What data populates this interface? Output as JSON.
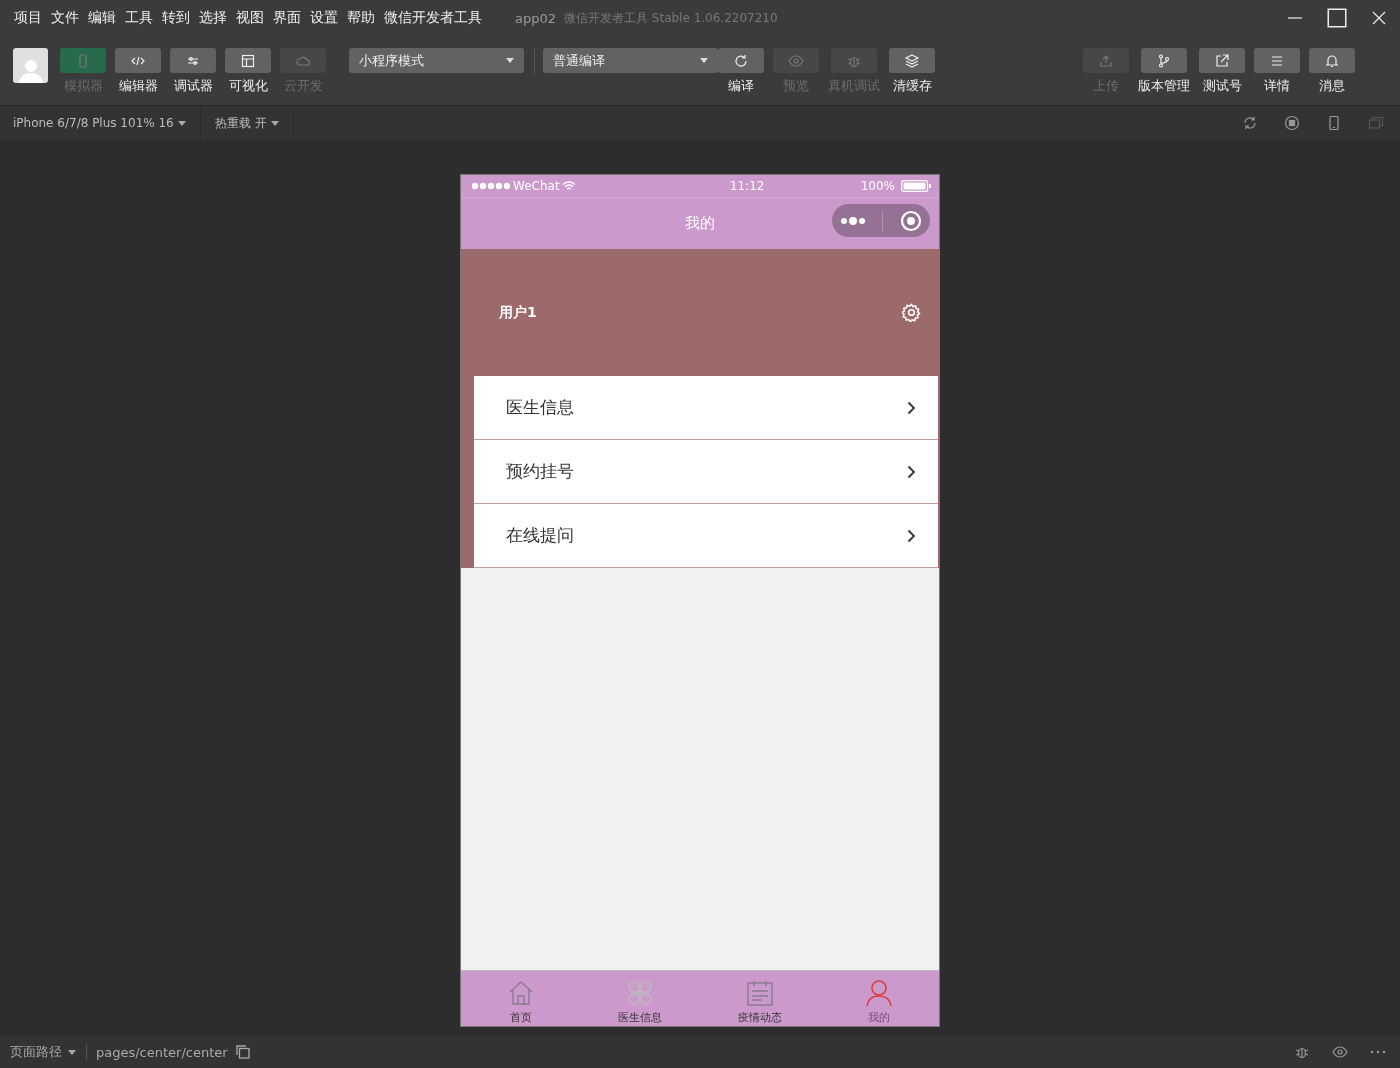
{
  "menu": [
    "项目",
    "文件",
    "编辑",
    "工具",
    "转到",
    "选择",
    "视图",
    "界面",
    "设置",
    "帮助",
    "微信开发者工具"
  ],
  "window": {
    "title": "app02",
    "subtitle": "微信开发者工具 Stable 1.06.2207210"
  },
  "left_tools": [
    {
      "label": "模拟器",
      "selected": true,
      "disabled": true
    },
    {
      "label": "编辑器",
      "selected": false,
      "disabled": false
    },
    {
      "label": "调试器",
      "selected": false,
      "disabled": false
    },
    {
      "label": "可视化",
      "selected": false,
      "disabled": false
    },
    {
      "label": "云开发",
      "selected": false,
      "disabled": true
    }
  ],
  "mode_select": {
    "value": "小程序模式"
  },
  "compile_select": {
    "value": "普通编译"
  },
  "compile_tools": [
    {
      "label": "编译",
      "disabled": false
    },
    {
      "label": "预览",
      "disabled": true
    },
    {
      "label": "真机调试",
      "disabled": true
    },
    {
      "label": "清缓存",
      "disabled": false
    }
  ],
  "right_tools": [
    {
      "label": "上传",
      "disabled": true
    },
    {
      "label": "版本管理",
      "disabled": false
    },
    {
      "label": "测试号",
      "disabled": false
    },
    {
      "label": "详情",
      "disabled": false
    },
    {
      "label": "消息",
      "disabled": false
    }
  ],
  "subbar": {
    "device": "iPhone 6/7/8 Plus 101% 16",
    "hot_reload": "热重载 开"
  },
  "phone": {
    "carrier": "WeChat",
    "time": "11:12",
    "battery": "100%",
    "nav_title": "我的",
    "username": "用户1",
    "menu_items": [
      "医生信息",
      "预约挂号",
      "在线提问"
    ],
    "tabs": [
      {
        "label": "首页",
        "selected": false
      },
      {
        "label": "医生信息",
        "selected": false
      },
      {
        "label": "疫情动态",
        "selected": false
      },
      {
        "label": "我的",
        "selected": true
      }
    ]
  },
  "status_bar": {
    "path_label": "页面路径",
    "path": "pages/center/center"
  }
}
